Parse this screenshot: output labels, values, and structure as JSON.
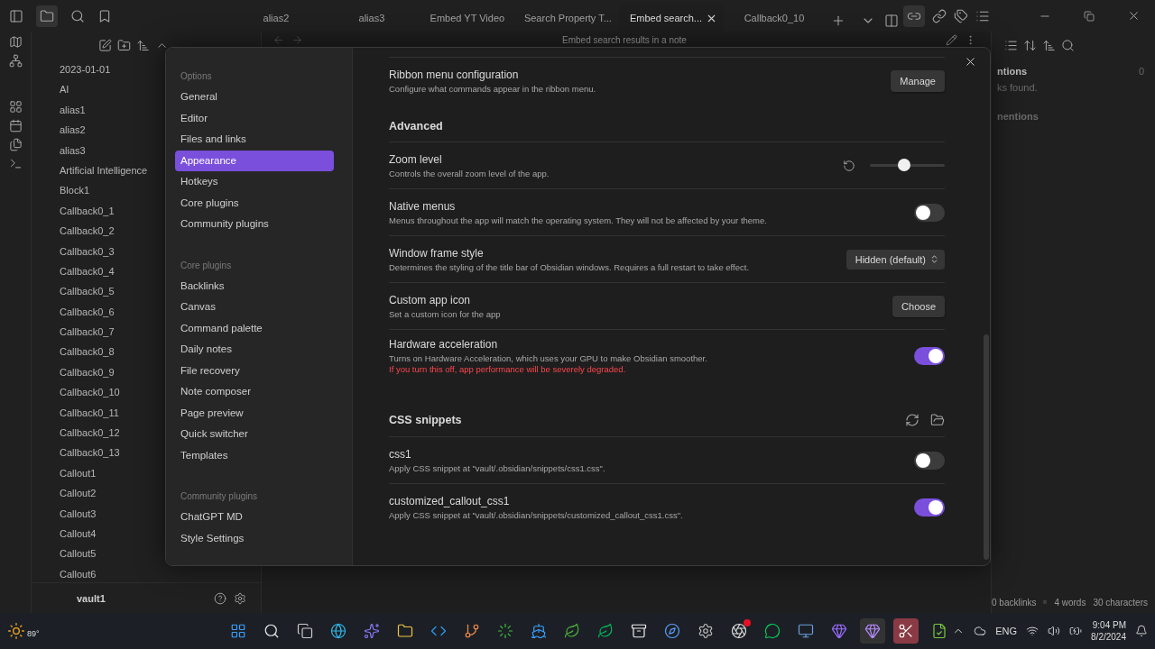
{
  "tabs": [
    {
      "label": "alias2",
      "selected": false
    },
    {
      "label": "alias3",
      "selected": false
    },
    {
      "label": "Embed YT Video",
      "selected": false
    },
    {
      "label": "Search Property T...",
      "selected": false
    },
    {
      "label": "Embed search...",
      "selected": true
    },
    {
      "label": "Callback0_10",
      "selected": false
    }
  ],
  "file_explorer": {
    "files": [
      "2023-01-01",
      "AI",
      "alias1",
      "alias2",
      "alias3",
      "Artificial Intelligence",
      "Block1",
      "Callback0_1",
      "Callback0_2",
      "Callback0_3",
      "Callback0_4",
      "Callback0_5",
      "Callback0_6",
      "Callback0_7",
      "Callback0_8",
      "Callback0_9",
      "Callback0_10",
      "Callback0_11",
      "Callback0_12",
      "Callback0_13",
      "Callout1",
      "Callout2",
      "Callout3",
      "Callout4",
      "Callout5",
      "Callout6"
    ],
    "vault": "vault1"
  },
  "editor": {
    "title": "Embed search results in a note"
  },
  "right_panel": {
    "heading": "ntions",
    "count": "0",
    "message": "ks found.",
    "subheading": "nentions"
  },
  "status_bar": [
    "0 backlinks",
    "4 words",
    "30 characters"
  ],
  "settings": {
    "sidebar": [
      {
        "heading": "Options",
        "items": [
          {
            "label": "General",
            "selected": false
          },
          {
            "label": "Editor",
            "selected": false
          },
          {
            "label": "Files and links",
            "selected": false
          },
          {
            "label": "Appearance",
            "selected": true
          },
          {
            "label": "Hotkeys",
            "selected": false
          },
          {
            "label": "Core plugins",
            "selected": false
          },
          {
            "label": "Community plugins",
            "selected": false
          }
        ]
      },
      {
        "heading": "Core plugins",
        "items": [
          {
            "label": "Backlinks",
            "selected": false
          },
          {
            "label": "Canvas",
            "selected": false
          },
          {
            "label": "Command palette",
            "selected": false
          },
          {
            "label": "Daily notes",
            "selected": false
          },
          {
            "label": "File recovery",
            "selected": false
          },
          {
            "label": "Note composer",
            "selected": false
          },
          {
            "label": "Page preview",
            "selected": false
          },
          {
            "label": "Quick switcher",
            "selected": false
          },
          {
            "label": "Templates",
            "selected": false
          }
        ]
      },
      {
        "heading": "Community plugins",
        "items": [
          {
            "label": "ChatGPT MD",
            "selected": false
          },
          {
            "label": "Style Settings",
            "selected": false
          }
        ]
      }
    ],
    "rows": [
      {
        "kind": "button",
        "name": "Ribbon menu configuration",
        "description": "Configure what commands appear in the ribbon menu.",
        "button": "Manage"
      },
      {
        "kind": "heading",
        "title": "Advanced"
      },
      {
        "kind": "slider",
        "name": "Zoom level",
        "description": "Controls the overall zoom level of the app.",
        "level": 0.46
      },
      {
        "kind": "toggle",
        "name": "Native menus",
        "description": "Menus throughout the app will match the operating system. They will not be affected by your theme.",
        "on": false
      },
      {
        "kind": "dropdown",
        "name": "Window frame style",
        "description": "Determines the styling of the title bar of Obsidian windows. Requires a full restart to take effect.",
        "value": "Hidden (default)"
      },
      {
        "kind": "button",
        "name": "Custom app icon",
        "description": "Set a custom icon for the app",
        "button": "Choose"
      },
      {
        "kind": "toggle",
        "name": "Hardware acceleration",
        "description": "Turns on Hardware Acceleration, which uses your GPU to make Obsidian smoother.",
        "warning": "If you turn this off, app performance will be severely degraded.",
        "on": true
      },
      {
        "kind": "heading_actions",
        "title": "CSS snippets"
      },
      {
        "kind": "toggle",
        "name": "css1",
        "description": "Apply CSS snippet at \"vault/.obsidian/snippets/css1.css\".",
        "on": false
      },
      {
        "kind": "toggle",
        "name": "customized_callout_css1",
        "description": "Apply CSS snippet at \"vault/.obsidian/snippets/customized_callout_css1.css\".",
        "on": true
      }
    ]
  },
  "taskbar": {
    "weather": "89°",
    "language": "ENG",
    "time": "9:04 PM",
    "date": "8/2/2024"
  }
}
